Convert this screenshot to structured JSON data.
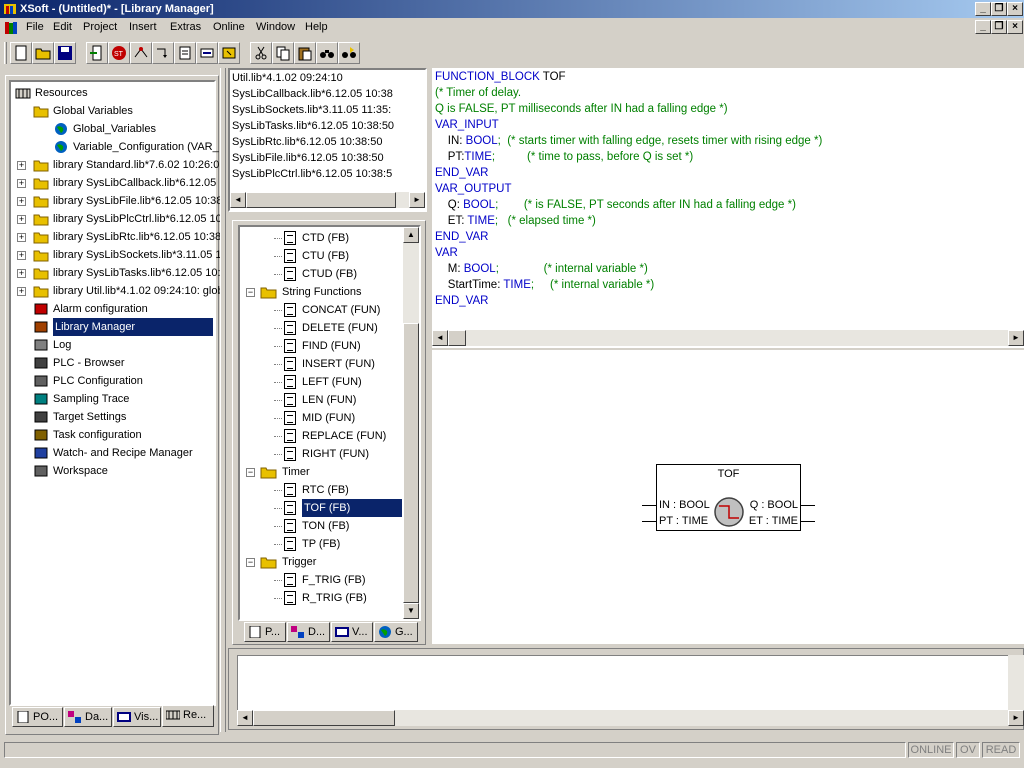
{
  "window": {
    "title": "XSoft - (Untitled)* - [Library Manager]"
  },
  "menu": [
    "File",
    "Edit",
    "Project",
    "Insert",
    "Extras",
    "Online",
    "Window",
    "Help"
  ],
  "resources_tree": {
    "root": "Resources",
    "items": [
      {
        "label": "Global Variables",
        "icon": "folder-open-icon"
      },
      {
        "label": "Global_Variables",
        "icon": "globe-icon"
      },
      {
        "label": "Variable_Configuration (VAR_",
        "icon": "globe-icon"
      },
      {
        "label": "library Standard.lib*7.6.02 10:26:0",
        "icon": "folder-icon"
      },
      {
        "label": "library SysLibCallback.lib*6.12.05 1",
        "icon": "folder-icon"
      },
      {
        "label": "library SysLibFile.lib*6.12.05 10:38",
        "icon": "folder-icon"
      },
      {
        "label": "library SysLibPlcCtrl.lib*6.12.05 10:",
        "icon": "folder-icon"
      },
      {
        "label": "library SysLibRtc.lib*6.12.05 10:38",
        "icon": "folder-icon"
      },
      {
        "label": "library SysLibSockets.lib*3.11.05 1",
        "icon": "folder-icon"
      },
      {
        "label": "library SysLibTasks.lib*6.12.05 10:",
        "icon": "folder-icon"
      },
      {
        "label": "library Util.lib*4.1.02 09:24:10: glob",
        "icon": "folder-icon"
      },
      {
        "label": "Alarm configuration",
        "icon": "alarm-icon"
      },
      {
        "label": "Library Manager",
        "icon": "books-icon"
      },
      {
        "label": "Log",
        "icon": "log-icon"
      },
      {
        "label": "PLC - Browser",
        "icon": "browser-icon"
      },
      {
        "label": "PLC Configuration",
        "icon": "plc-config-icon"
      },
      {
        "label": "Sampling Trace",
        "icon": "trace-icon"
      },
      {
        "label": "Target Settings",
        "icon": "target-icon"
      },
      {
        "label": "Task configuration",
        "icon": "task-icon"
      },
      {
        "label": "Watch- and Recipe Manager",
        "icon": "watch-icon"
      },
      {
        "label": "Workspace",
        "icon": "workspace-icon"
      }
    ],
    "tabs": [
      "PO...",
      "Da...",
      "Vis...",
      "Re..."
    ]
  },
  "library_list": [
    "Util.lib*4.1.02 09:24:10",
    "SysLibCallback.lib*6.12.05 10:38",
    "SysLibSockets.lib*3.11.05 11:35:",
    "SysLibTasks.lib*6.12.05 10:38:50",
    "SysLibRtc.lib*6.12.05 10:38:50",
    "SysLibFile.lib*6.12.05 10:38:50",
    "SysLibPlcCtrl.lib*6.12.05 10:38:5"
  ],
  "pou_tree": {
    "items": [
      {
        "label": "CTD (FB)",
        "type": "doc"
      },
      {
        "label": "CTU (FB)",
        "type": "doc"
      },
      {
        "label": "CTUD (FB)",
        "type": "doc"
      },
      {
        "label": "String Functions",
        "type": "folder"
      },
      {
        "label": "CONCAT (FUN)",
        "type": "doc"
      },
      {
        "label": "DELETE (FUN)",
        "type": "doc"
      },
      {
        "label": "FIND (FUN)",
        "type": "doc"
      },
      {
        "label": "INSERT (FUN)",
        "type": "doc"
      },
      {
        "label": "LEFT (FUN)",
        "type": "doc"
      },
      {
        "label": "LEN (FUN)",
        "type": "doc"
      },
      {
        "label": "MID (FUN)",
        "type": "doc"
      },
      {
        "label": "REPLACE (FUN)",
        "type": "doc"
      },
      {
        "label": "RIGHT (FUN)",
        "type": "doc"
      },
      {
        "label": "Timer",
        "type": "folder"
      },
      {
        "label": "RTC (FB)",
        "type": "doc"
      },
      {
        "label": "TOF (FB)",
        "type": "doc",
        "selected": true
      },
      {
        "label": "TON (FB)",
        "type": "doc"
      },
      {
        "label": "TP (FB)",
        "type": "doc"
      },
      {
        "label": "Trigger",
        "type": "folder"
      },
      {
        "label": "F_TRIG (FB)",
        "type": "doc"
      },
      {
        "label": "R_TRIG (FB)",
        "type": "doc"
      }
    ],
    "tabs": [
      "P...",
      "D...",
      "V...",
      "G..."
    ]
  },
  "code": {
    "line1_kw": "FUNCTION_BLOCK",
    "line1_name": " TOF",
    "line2": "(* Timer of delay.",
    "line3": "Q is FALSE, PT milliseconds after IN had a falling edge *)",
    "var_input": "VAR_INPUT",
    "in_decl": "    IN: ",
    "in_type": "BOOL",
    "in_comment": ";  (* starts timer with falling edge, resets timer with rising edge *)",
    "pt_decl": "    PT:",
    "pt_type": "TIME",
    "pt_comment": ";          (* time to pass, before Q is set *)",
    "end_var1": "END_VAR",
    "var_output": "VAR_OUTPUT",
    "q_decl": "    Q: ",
    "q_type": "BOOL",
    "q_comment": ";        (* is FALSE, PT seconds after IN had a falling edge *)",
    "et_decl": "    ET: ",
    "et_type": "TIME",
    "et_comment": ";   (* elapsed time *)",
    "end_var2": "END_VAR",
    "var": "VAR",
    "m_decl": "    M: ",
    "m_type": "BOOL",
    "m_comment": ";              (* internal variable *)",
    "st_decl": "    StartTime: ",
    "st_type": "TIME",
    "st_comment": ";     (* internal variable *)",
    "end_var3": "END_VAR"
  },
  "fb_block": {
    "name": "TOF",
    "in1": "IN : BOOL",
    "in2": "PT : TIME",
    "out1": "Q : BOOL",
    "out2": "ET : TIME"
  },
  "status": {
    "online": "ONLINE",
    "ov": "OV",
    "read": "READ"
  }
}
